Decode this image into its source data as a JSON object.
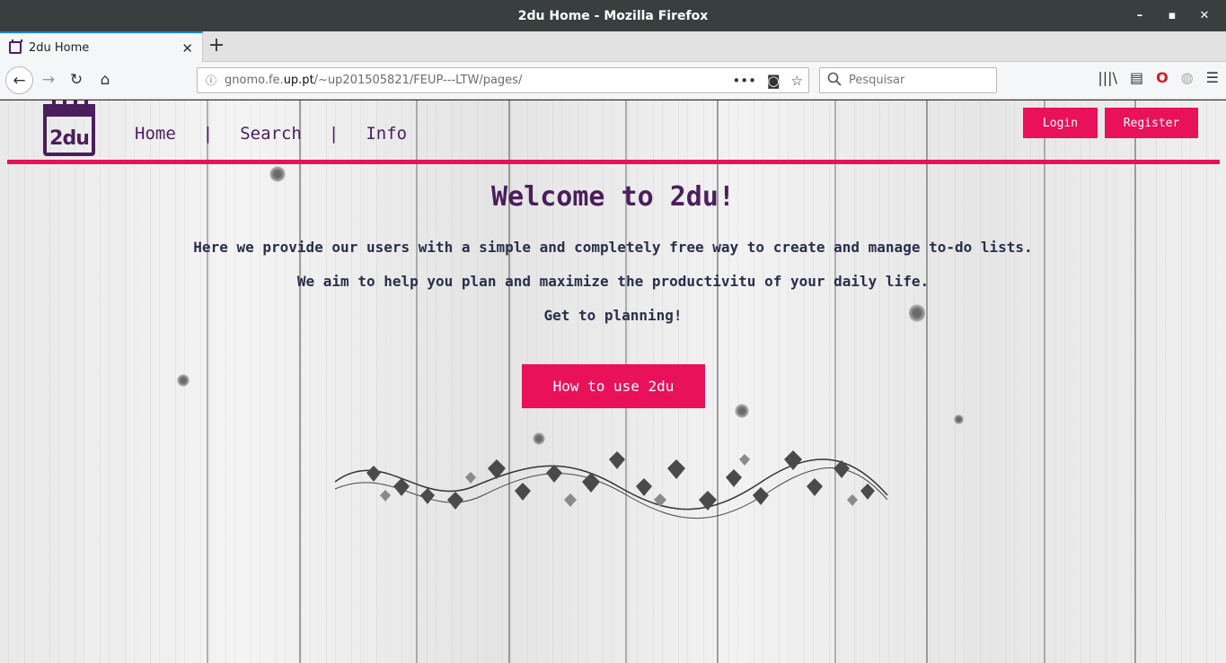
{
  "window": {
    "title": "2du Home - Mozilla Firefox",
    "minimize": "–",
    "maximize": "▪",
    "close": "✕"
  },
  "tab": {
    "label": "2du Home",
    "close": "✕",
    "new_tab": "+"
  },
  "nav": {
    "back": "←",
    "forward": "→",
    "reload": "↻",
    "home": "⌂",
    "url_prefix": "gnomo.fe.",
    "url_domain": "up.pt",
    "url_suffix": "/~up201505821/FEUP---LTW/pages/",
    "url_info": "ⓘ",
    "page_actions": "•••",
    "pocket": "◙",
    "bookmark": "☆",
    "search_placeholder": "Pesquisar",
    "library": "|||\\",
    "sidebar": "▤",
    "opera": "O",
    "globe": "◍",
    "menu": "☰"
  },
  "site": {
    "logo_text": "2du",
    "menu": [
      {
        "label": "Home"
      },
      {
        "label": "Search"
      },
      {
        "label": "Info"
      }
    ],
    "separator": "|",
    "login_label": "Login",
    "register_label": "Register",
    "welcome": "Welcome to 2du!",
    "line1": "Here we provide our users with a simple and completely free way to create and manage to-do lists.",
    "line2": "We aim to help you plan and maximize the productivitu of your daily life.",
    "line3": "Get to planning!",
    "howto_label": "How to use 2du",
    "accent": "#e8115a",
    "brand": "#4b1e5c"
  }
}
